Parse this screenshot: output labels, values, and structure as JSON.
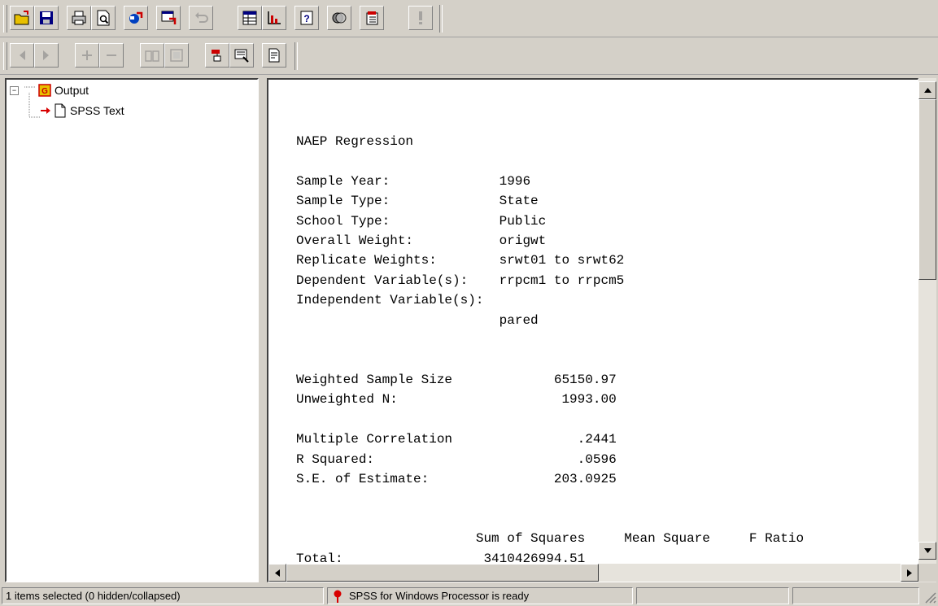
{
  "toolbar1": {
    "buttons": [
      "open-icon",
      "save-icon",
      "print-icon",
      "print-preview-icon",
      "export-icon",
      "dialog-recall-icon",
      "undo-icon",
      "goto-data-icon",
      "goto-chart-icon",
      "variables-icon",
      "use-sets-icon",
      "designate-window-icon",
      "run-icon"
    ]
  },
  "toolbar2": {
    "buttons": [
      "promote-icon",
      "demote-icon",
      "expand-icon",
      "collapse-icon",
      "show-icon",
      "hide-icon",
      "insert-heading-icon",
      "insert-title-icon",
      "insert-text-icon"
    ]
  },
  "tree": {
    "root_label": "Output",
    "child_label": "SPSS Text"
  },
  "output": {
    "text": "NAEP Regression\n\nSample Year:              1996\nSample Type:              State\nSchool Type:              Public\nOverall Weight:           origwt\nReplicate Weights:        srwt01 to srwt62\nDependent Variable(s):    rrpcm1 to rrpcm5\nIndependent Variable(s):\n                          pared\n\n\nWeighted Sample Size             65150.97\nUnweighted N:                     1993.00\n\nMultiple Correlation                .2441\nR Squared:                          .0596\nS.E. of Estimate:                203.0925\n\n\n                       Sum of Squares     Mean Square     F Ratio\nTotal:                  3410426994.51"
  },
  "status": {
    "selection": "1 items selected (0 hidden/collapsed)",
    "processor": "SPSS for Windows Processor is ready"
  },
  "colors": {
    "chrome": "#d4d0c8",
    "pane_bg": "#ffffff",
    "accent_red": "#d80000"
  }
}
